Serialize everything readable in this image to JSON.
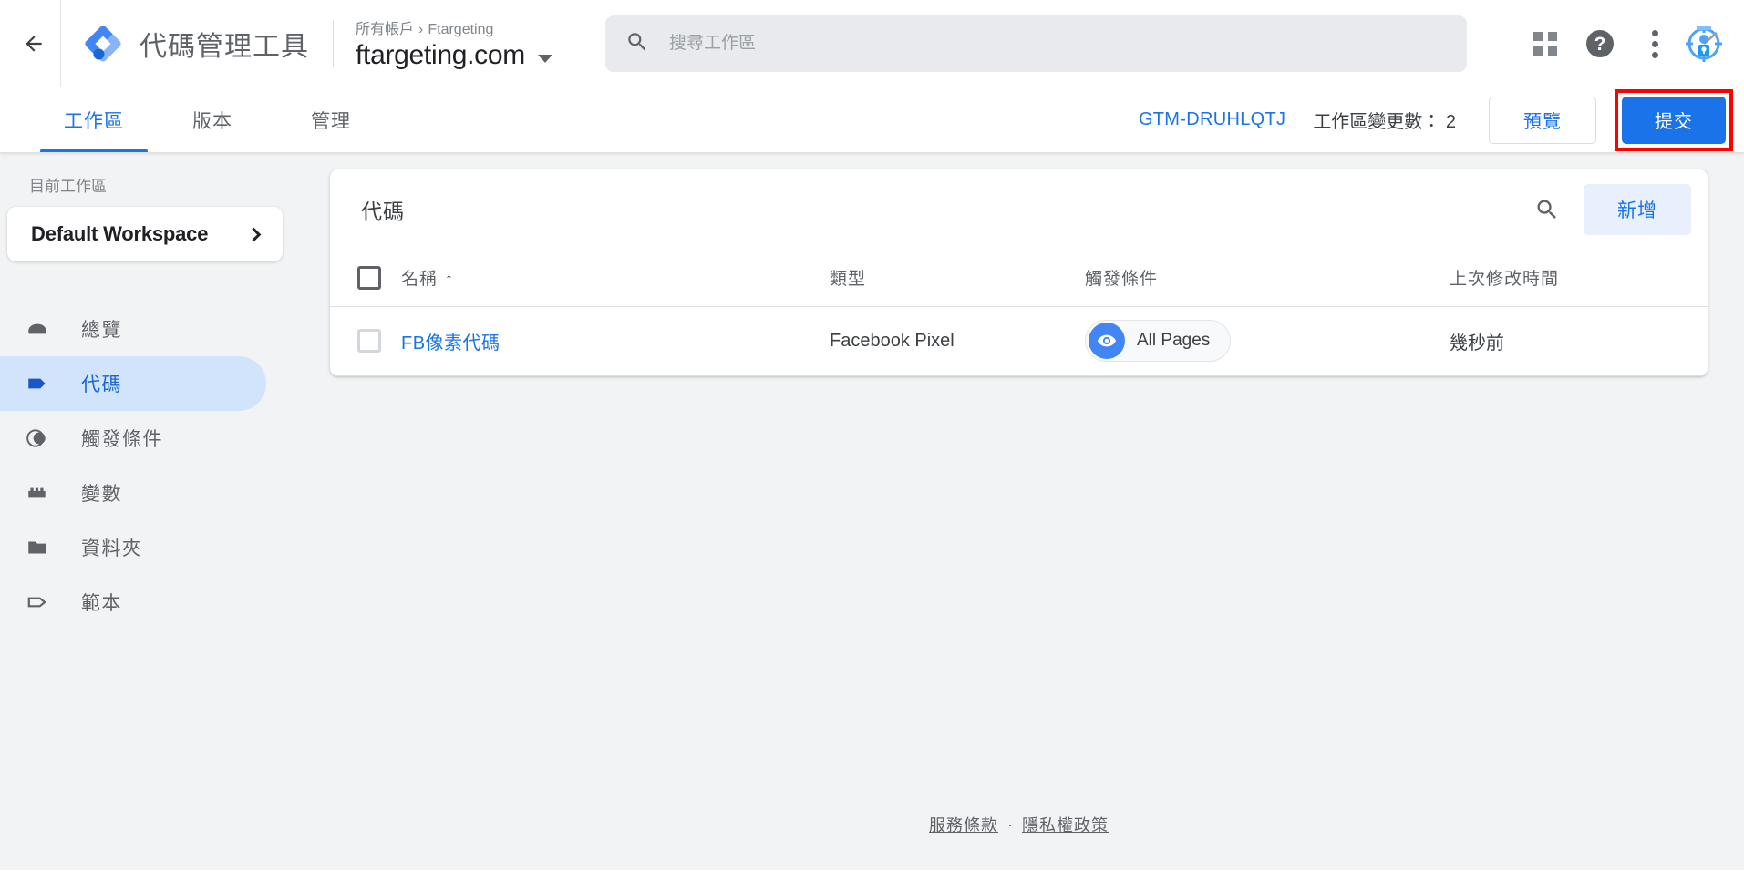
{
  "header": {
    "back_icon": "arrow-left-icon",
    "product_name": "代碼管理工具",
    "logo_icon": "gtm-logo-icon",
    "breadcrumb": {
      "root": "所有帳戶",
      "separator": "›",
      "account": "Ftargeting"
    },
    "container_name": "ftargeting.com",
    "container_caret_icon": "chevron-down-icon",
    "search": {
      "icon": "search-icon",
      "placeholder": "搜尋工作區",
      "value": ""
    },
    "icons": {
      "apps": "apps-grid-icon",
      "help": "help-circle-icon",
      "more": "more-vert-icon",
      "avatar": "user-avatar-icon"
    }
  },
  "tabbar": {
    "tabs": [
      {
        "label": "工作區",
        "active": true
      },
      {
        "label": "版本",
        "active": false
      },
      {
        "label": "管理",
        "active": false
      }
    ],
    "gtm_id": "GTM-DRUHLQTJ",
    "changes_label": "工作區變更數： 2",
    "preview_label": "預覽",
    "submit_label": "提交",
    "submit_highlight_color": "#ff0000",
    "accent_color": "#1a73e8"
  },
  "sidebar": {
    "workspace_label": "目前工作區",
    "workspace_name": "Default Workspace",
    "workspace_chevron_icon": "chevron-right-icon",
    "items": [
      {
        "label": "總覽",
        "icon": "overview-icon",
        "active": false
      },
      {
        "label": "代碼",
        "icon": "tag-icon",
        "active": true
      },
      {
        "label": "觸發條件",
        "icon": "trigger-icon",
        "active": false
      },
      {
        "label": "變數",
        "icon": "variable-icon",
        "active": false
      },
      {
        "label": "資料夾",
        "icon": "folder-icon",
        "active": false
      },
      {
        "label": "範本",
        "icon": "template-icon",
        "active": false
      }
    ],
    "active_bg_color": "#d2e3fc",
    "active_text_color": "#1967d2"
  },
  "main": {
    "card_title": "代碼",
    "search_icon": "search-icon",
    "add_button_label": "新增",
    "table": {
      "columns": [
        {
          "key": "checkbox",
          "label": ""
        },
        {
          "key": "name",
          "label": "名稱",
          "sorted": true,
          "sort_icon": "↑"
        },
        {
          "key": "type",
          "label": "類型"
        },
        {
          "key": "trigger",
          "label": "觸發條件"
        },
        {
          "key": "modified",
          "label": "上次修改時間"
        }
      ],
      "rows": [
        {
          "checked": false,
          "name": "FB像素代碼",
          "type": "Facebook Pixel",
          "trigger": {
            "label": "All Pages",
            "icon": "eye-icon"
          },
          "modified": "幾秒前"
        }
      ]
    }
  },
  "footer": {
    "terms_label": "服務條款",
    "separator": "·",
    "privacy_label": "隱私權政策"
  }
}
